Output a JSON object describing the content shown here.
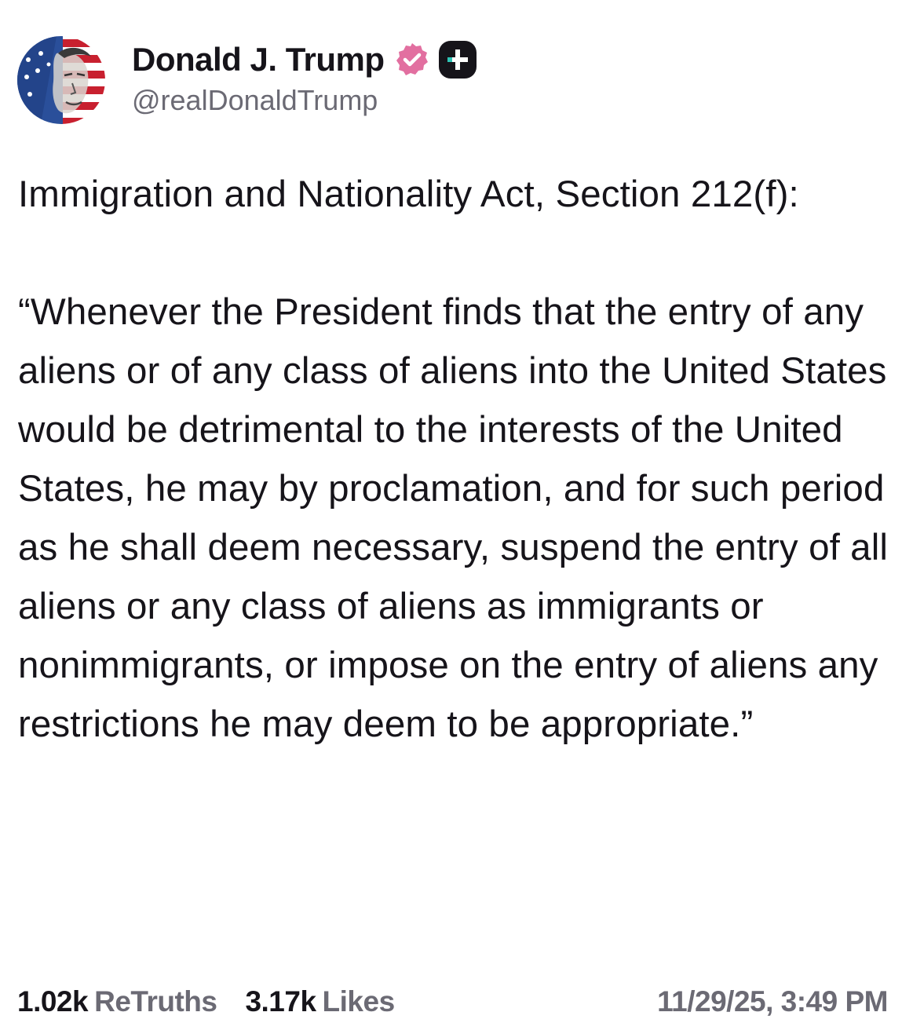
{
  "author": {
    "display_name": "Donald J. Trump",
    "handle": "@realDonaldTrump",
    "avatar_icon": "avatar-portrait-flag",
    "verified_icon": "verified-badge-icon",
    "verified_color": "#e26fa0",
    "subscription_icon": "truth-plus-icon"
  },
  "post": {
    "heading": "Immigration and Nationality Act, Section 212(f):",
    "quote": "“Whenever the President finds that the entry of any aliens or of any class of aliens into the United States would be detrimental to the interests of the United States, he may by proclamation, and for such period as he shall deem necessary, suspend the entry of all aliens or any class of aliens as immigrants or nonimmigrants, or impose on the entry of aliens any restrictions he may deem to be appropriate.”"
  },
  "footer": {
    "retruths_count": "1.02k",
    "retruths_label": "ReTruths",
    "likes_count": "3.17k",
    "likes_label": "Likes",
    "timestamp": "11/29/25, 3:49 PM"
  }
}
